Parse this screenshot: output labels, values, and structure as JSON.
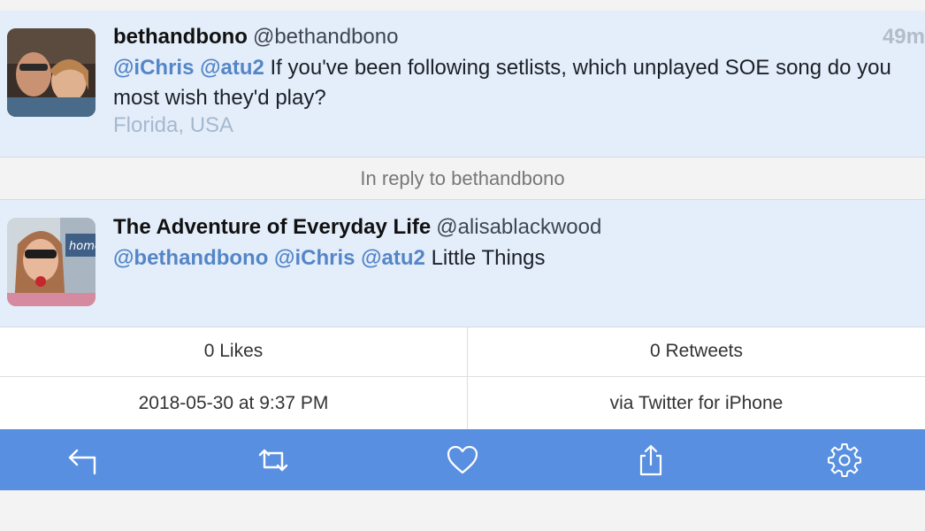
{
  "original_tweet": {
    "display_name": "bethandbono",
    "handle": "@bethandbono",
    "time": "49m",
    "mention_1": "@iChris",
    "mention_2": "@atu2",
    "text": "If you've been following setlists, which unplayed SOE song do you most wish they'd play?",
    "location": "Florida, USA"
  },
  "reply_divider": "In reply to bethandbono",
  "reply_tweet": {
    "display_name": "The Adventure of Everyday Life",
    "handle": "@alisablackwood",
    "mention_1": "@bethandbono",
    "mention_2": "@iChris",
    "mention_3": "@atu2",
    "text": "Little Things"
  },
  "stats": {
    "likes": "0 Likes",
    "retweets": "0 Retweets",
    "date": "2018-05-30 at 9:37 PM",
    "source": "via Twitter for iPhone"
  },
  "toolbar": {
    "icons": [
      "reply-icon",
      "retweet-icon",
      "heart-icon",
      "share-icon",
      "gear-icon"
    ]
  },
  "colors": {
    "tweet_bg": "#e4eefb",
    "mention": "#5486c7",
    "toolbar_bg": "#588fe0"
  }
}
